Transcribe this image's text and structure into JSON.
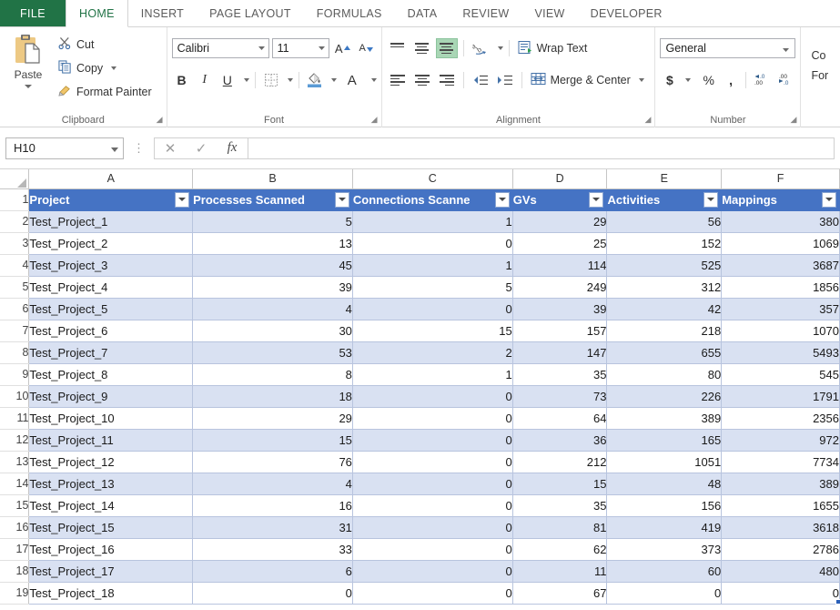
{
  "app": {
    "file_tab": "FILE",
    "tabs": [
      "HOME",
      "INSERT",
      "PAGE LAYOUT",
      "FORMULAS",
      "DATA",
      "REVIEW",
      "VIEW",
      "DEVELOPER"
    ],
    "active_tab": "HOME",
    "accent_green": "#217346",
    "table_header_blue": "#4573c4",
    "band_blue": "#d9e1f2"
  },
  "ribbon": {
    "clipboard": {
      "label": "Clipboard",
      "paste": "Paste",
      "cut": "Cut",
      "copy": "Copy",
      "format_painter": "Format Painter"
    },
    "font": {
      "label": "Font",
      "font_name": "Calibri",
      "font_size": "11",
      "bold": "B",
      "italic": "I",
      "underline": "U",
      "grow_font": "A",
      "shrink_font": "A",
      "fill_color": "A",
      "font_color": "A"
    },
    "alignment": {
      "label": "Alignment",
      "wrap_text": "Wrap Text",
      "merge_center": "Merge & Center"
    },
    "number": {
      "label": "Number",
      "format": "General",
      "currency": "$",
      "percent": "%",
      "comma": ",",
      "increase_decimal": ".00",
      "decrease_decimal": ".00"
    },
    "styles": {
      "line1": "Co",
      "line2": "For"
    }
  },
  "formula_bar": {
    "name_box": "H10",
    "formula": "",
    "cancel": "✕",
    "enter": "✓",
    "insert_function": "fx"
  },
  "sheet": {
    "column_letters": [
      "A",
      "B",
      "C",
      "D",
      "E",
      "F"
    ],
    "row_numbers": [
      "1",
      "2",
      "3",
      "4",
      "5",
      "6",
      "7",
      "8",
      "9",
      "10",
      "11",
      "12",
      "13",
      "14",
      "15",
      "16",
      "17",
      "18",
      "19"
    ],
    "headers": [
      "Project",
      "Processes Scanned",
      "Connections Scanne",
      "GVs",
      "Activities",
      "Mappings"
    ],
    "rows": [
      {
        "n": "2",
        "cells": [
          "Test_Project_1",
          "5",
          "1",
          "29",
          "56",
          "380"
        ]
      },
      {
        "n": "3",
        "cells": [
          "Test_Project_2",
          "13",
          "0",
          "25",
          "152",
          "1069"
        ]
      },
      {
        "n": "4",
        "cells": [
          "Test_Project_3",
          "45",
          "1",
          "114",
          "525",
          "3687"
        ]
      },
      {
        "n": "5",
        "cells": [
          "Test_Project_4",
          "39",
          "5",
          "249",
          "312",
          "1856"
        ]
      },
      {
        "n": "6",
        "cells": [
          "Test_Project_5",
          "4",
          "0",
          "39",
          "42",
          "357"
        ]
      },
      {
        "n": "7",
        "cells": [
          "Test_Project_6",
          "30",
          "15",
          "157",
          "218",
          "1070"
        ]
      },
      {
        "n": "8",
        "cells": [
          "Test_Project_7",
          "53",
          "2",
          "147",
          "655",
          "5493"
        ]
      },
      {
        "n": "9",
        "cells": [
          "Test_Project_8",
          "8",
          "1",
          "35",
          "80",
          "545"
        ]
      },
      {
        "n": "10",
        "cells": [
          "Test_Project_9",
          "18",
          "0",
          "73",
          "226",
          "1791"
        ]
      },
      {
        "n": "11",
        "cells": [
          "Test_Project_10",
          "29",
          "0",
          "64",
          "389",
          "2356"
        ]
      },
      {
        "n": "12",
        "cells": [
          "Test_Project_11",
          "15",
          "0",
          "36",
          "165",
          "972"
        ]
      },
      {
        "n": "13",
        "cells": [
          "Test_Project_12",
          "76",
          "0",
          "212",
          "1051",
          "7734"
        ]
      },
      {
        "n": "14",
        "cells": [
          "Test_Project_13",
          "4",
          "0",
          "15",
          "48",
          "389"
        ]
      },
      {
        "n": "15",
        "cells": [
          "Test_Project_14",
          "16",
          "0",
          "35",
          "156",
          "1655"
        ]
      },
      {
        "n": "16",
        "cells": [
          "Test_Project_15",
          "31",
          "0",
          "81",
          "419",
          "3618"
        ]
      },
      {
        "n": "17",
        "cells": [
          "Test_Project_16",
          "33",
          "0",
          "62",
          "373",
          "2786"
        ]
      },
      {
        "n": "18",
        "cells": [
          "Test_Project_17",
          "6",
          "0",
          "11",
          "60",
          "480"
        ]
      },
      {
        "n": "19",
        "cells": [
          "Test_Project_18",
          "0",
          "0",
          "67",
          "0",
          "0"
        ]
      }
    ]
  }
}
